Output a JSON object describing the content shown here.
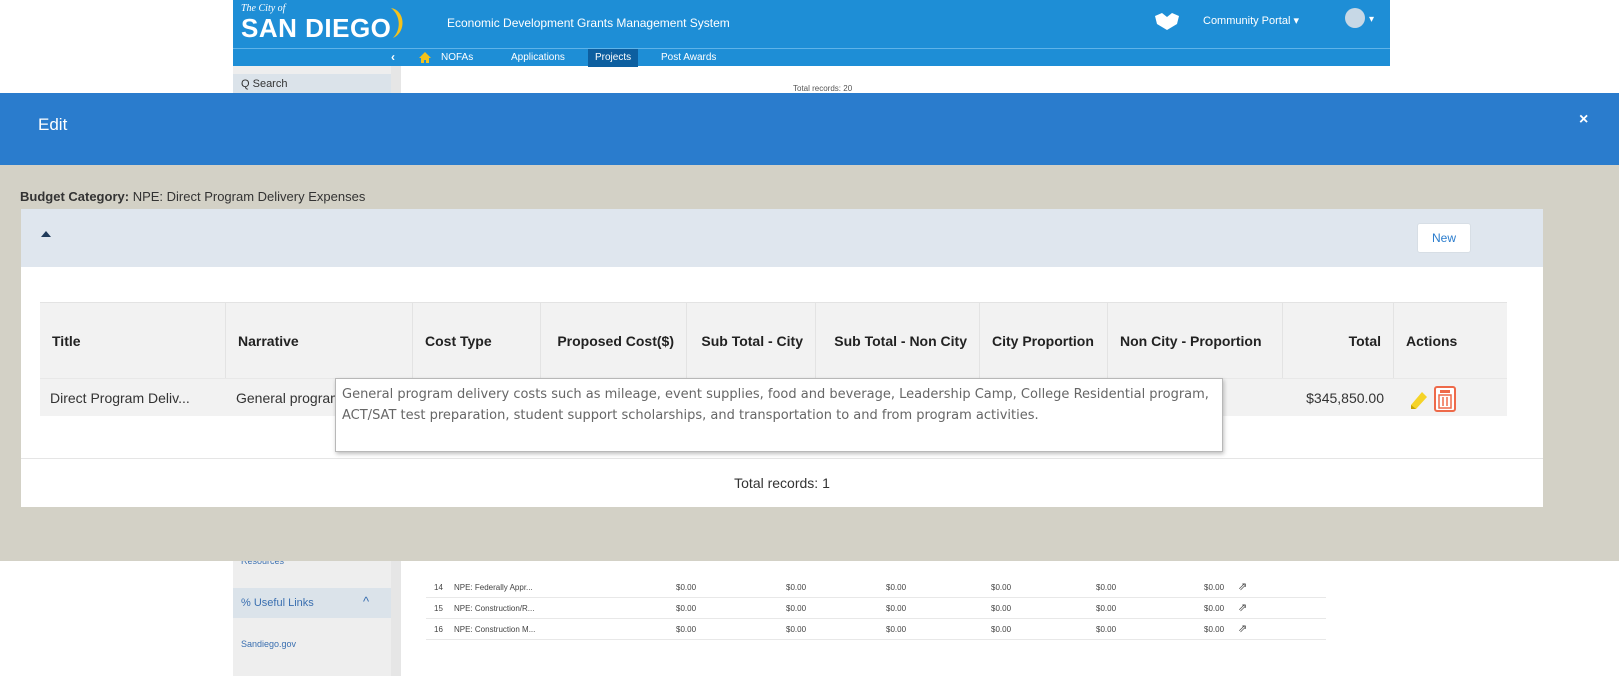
{
  "header": {
    "logo_small": "The City of",
    "logo_big": "SAN DIEGO",
    "system_title": "Economic Development Grants Management System",
    "portal_label": "Community Portal ▾",
    "brand_color": "#1e8ed6"
  },
  "nav": {
    "back_glyph": "‹",
    "items": [
      "NOFAs",
      "Applications",
      "Projects",
      "Post Awards"
    ],
    "active": "Projects"
  },
  "sidebar": {
    "search_label": "Q Search",
    "resources_label": "Resources",
    "useful_links_label": "% Useful Links",
    "collapse_glyph": "^",
    "sandiego_link": "Sandiego.gov"
  },
  "background": {
    "total_records": "Total records: 20",
    "rows": [
      {
        "num": "14",
        "name": "NPE: Federally Appr...",
        "vals": [
          "$0.00",
          "$0.00",
          "$0.00",
          "$0.00",
          "$0.00",
          "$0.00"
        ]
      },
      {
        "num": "15",
        "name": "NPE: Construction/R...",
        "vals": [
          "$0.00",
          "$0.00",
          "$0.00",
          "$0.00",
          "$0.00",
          "$0.00"
        ]
      },
      {
        "num": "16",
        "name": "NPE: Construction M...",
        "vals": [
          "$0.00",
          "$0.00",
          "$0.00",
          "$0.00",
          "$0.00",
          "$0.00"
        ]
      }
    ]
  },
  "modal": {
    "title": "Edit",
    "close_glyph": "×",
    "budget_category_label": "Budget Category:",
    "budget_category_value": "NPE: Direct Program Delivery Expenses",
    "new_button": "New",
    "columns": [
      "Title",
      "Narrative",
      "Cost Type",
      "Proposed Cost($)",
      "Sub Total - City",
      "Sub Total - Non City",
      "City Proportion",
      "Non City - Proportion",
      "Total",
      "Actions"
    ],
    "rows": [
      {
        "title": "Direct Program Deliv...",
        "narrative": "General program",
        "total": "$345,850.00"
      }
    ],
    "tooltip": "General program delivery costs such as mileage, event supplies, food and beverage, Leadership Camp, College Residential program, ACT/SAT test preparation, student support scholarships, and transportation to and from program activities.",
    "total_records": "Total records: 1"
  }
}
